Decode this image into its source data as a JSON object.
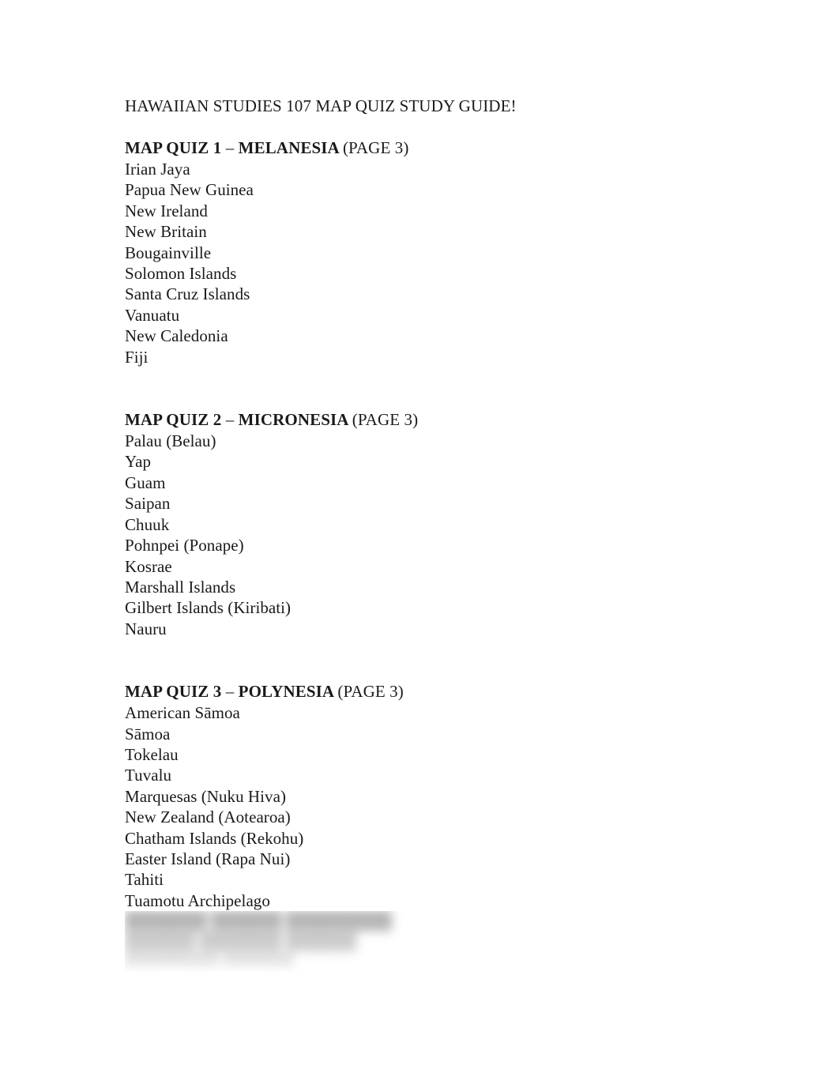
{
  "document": {
    "title": "HAWAIIAN STUDIES 107 MAP QUIZ STUDY GUIDE!",
    "sections": [
      {
        "heading_main": "MAP QUIZ 1",
        "heading_dash": "–",
        "heading_region": "MELANESIA",
        "heading_page": "(PAGE 3)",
        "items": [
          "Irian Jaya",
          "Papua New Guinea",
          "New Ireland",
          "New Britain",
          "Bougainville",
          "Solomon Islands",
          "Santa Cruz Islands",
          "Vanuatu",
          "New Caledonia",
          "Fiji"
        ]
      },
      {
        "heading_main": "MAP QUIZ 2",
        "heading_dash": "–",
        "heading_region": "MICRONESIA",
        "heading_page": "(PAGE 3)",
        "items": [
          "Palau (Belau)",
          "Yap",
          "Guam",
          "Saipan",
          "Chuuk",
          "Pohnpei (Ponape)",
          "Kosrae",
          "Marshall Islands",
          "Gilbert Islands (Kiribati)",
          "Nauru"
        ]
      },
      {
        "heading_main": "MAP QUIZ 3",
        "heading_dash": "–",
        "heading_region": "POLYNESIA",
        "heading_page": "(PAGE 3)",
        "items": [
          "American Sāmoa",
          "Sāmoa",
          "Tokelau",
          "Tuvalu",
          "Marquesas (Nuku Hiva)",
          "New Zealand (Aotearoa)",
          "Chatham Islands (Rekohu)",
          "Easter Island (Rapa Nui)",
          "Tahiti",
          "Tuamotu Archipelago"
        ],
        "obscured_items": [
          "███████ ██████ █████████",
          "██████ ███████ ██████",
          "████████ ██████"
        ]
      }
    ]
  }
}
